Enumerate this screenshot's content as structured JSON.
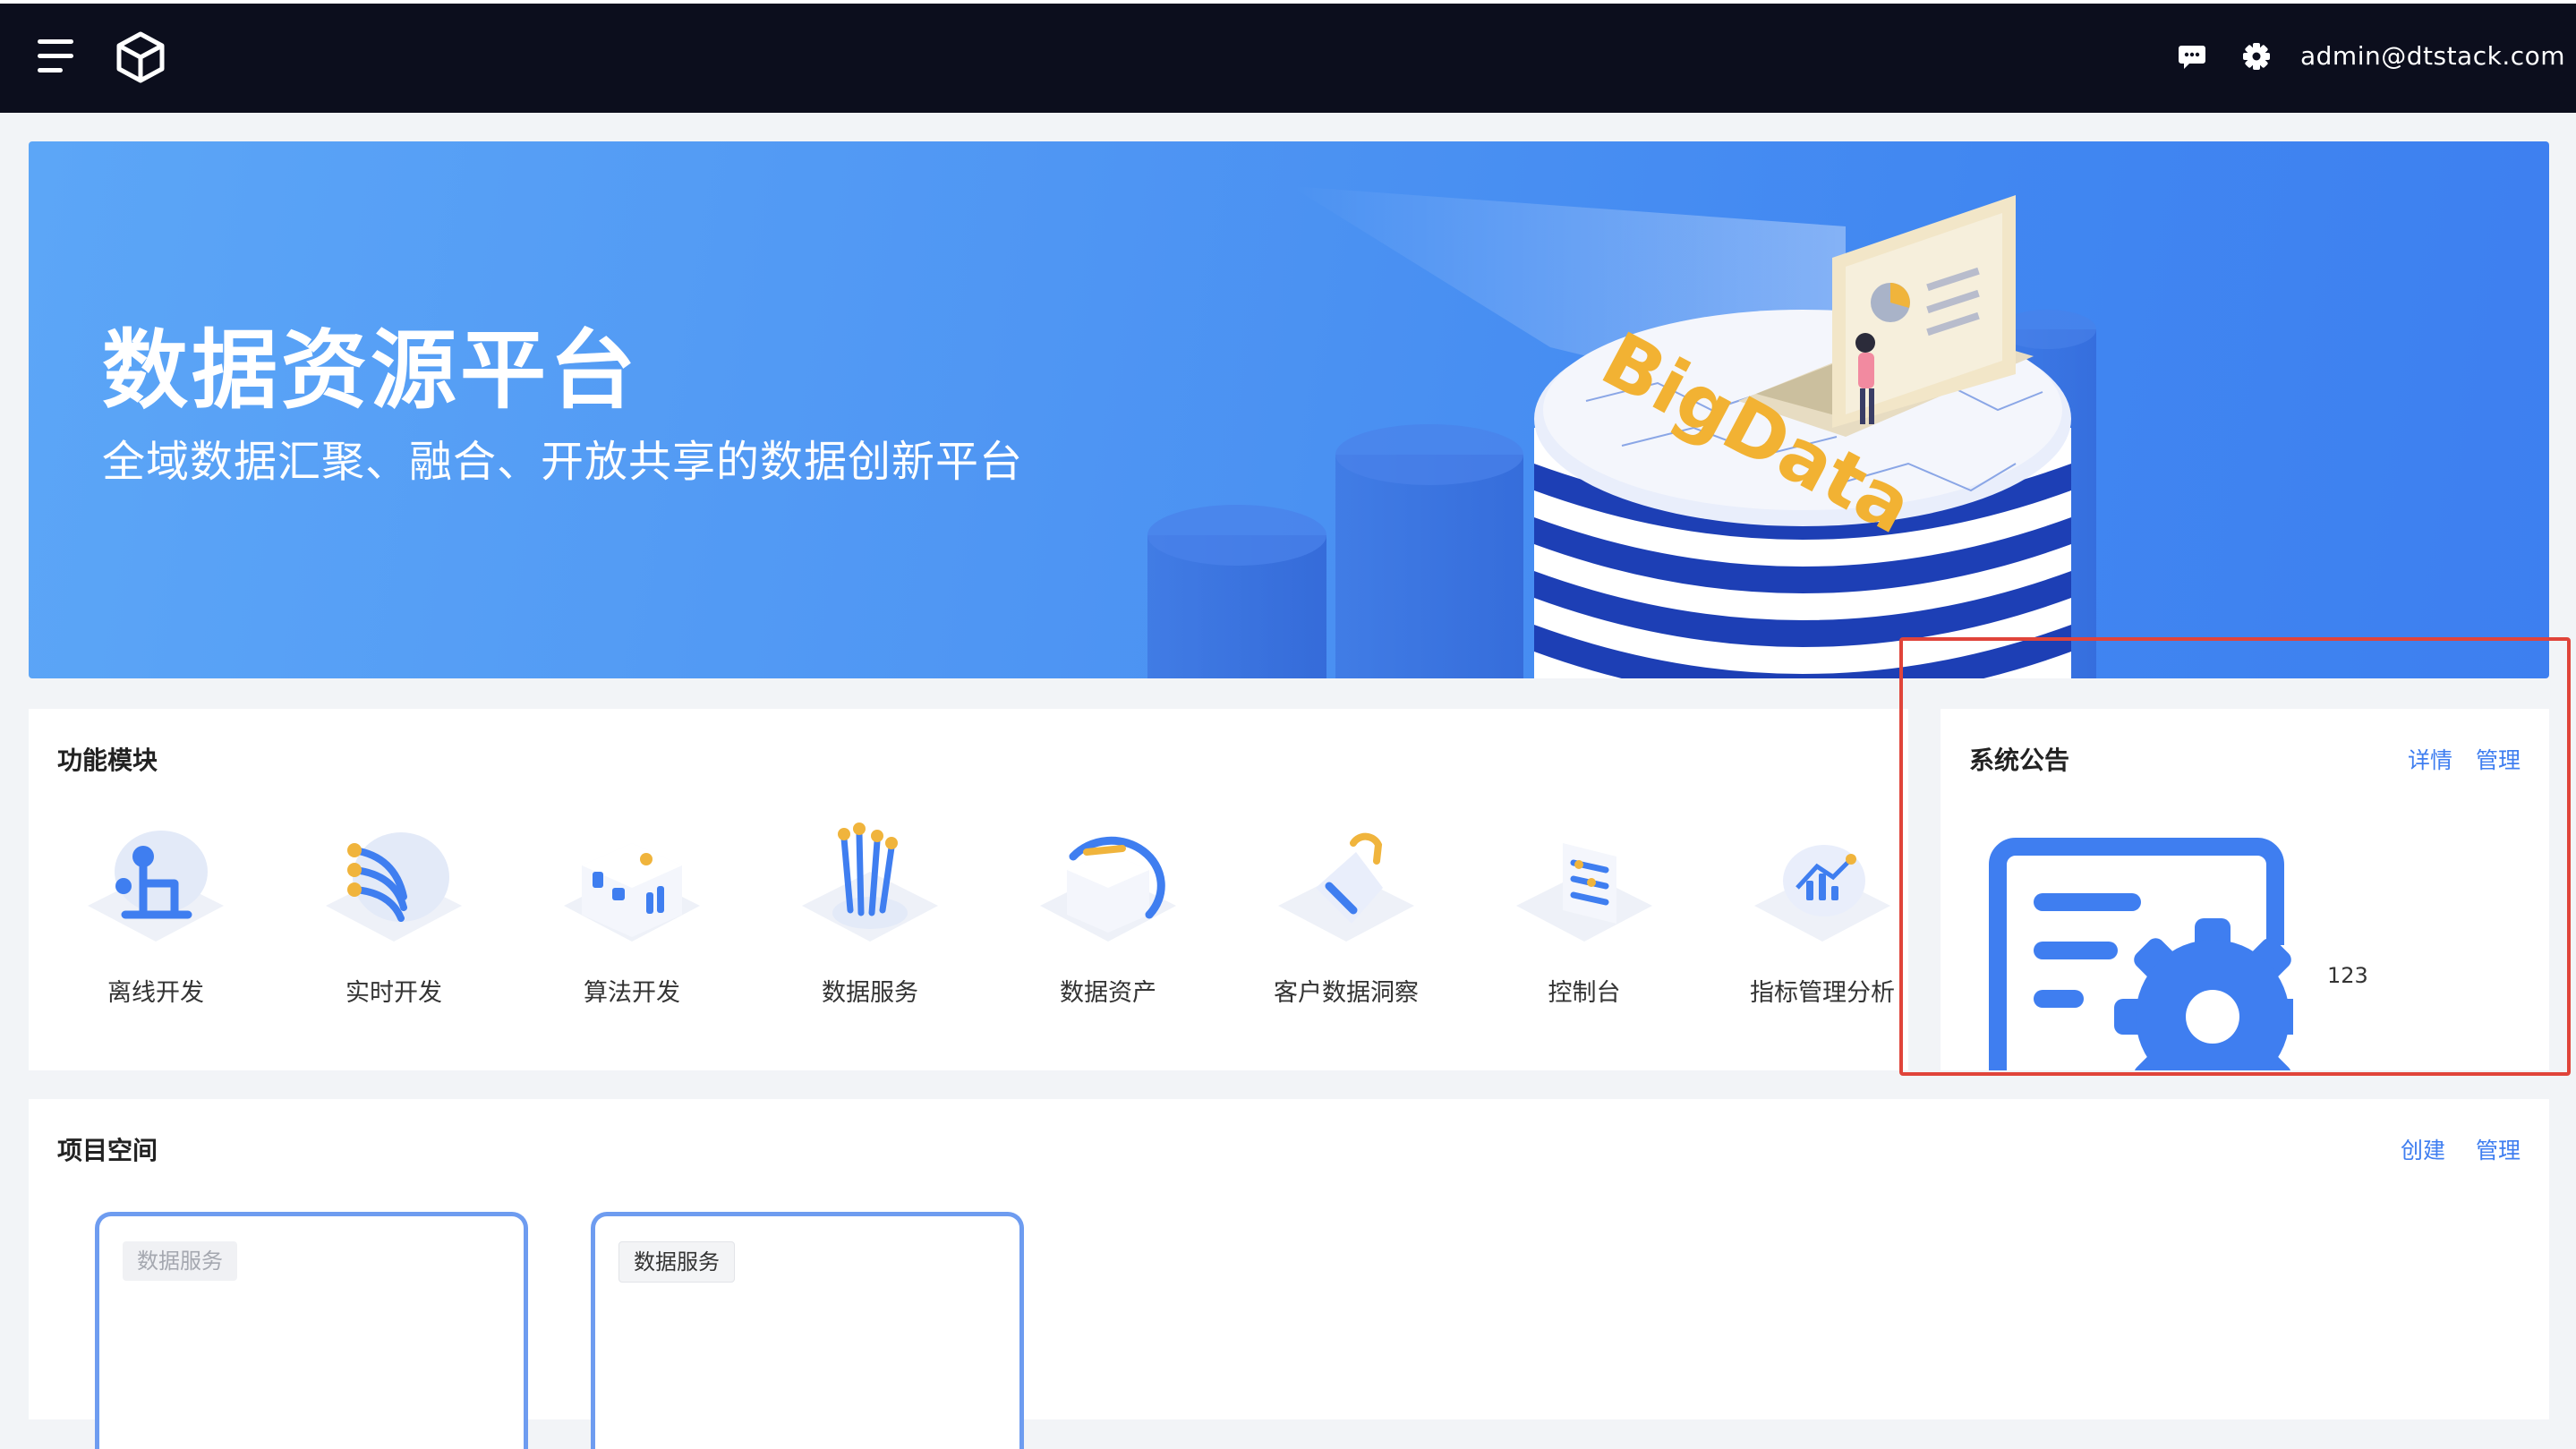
{
  "header": {
    "user": "admin@dtstack.com",
    "icons": [
      "menu-icon",
      "cube-logo-icon",
      "message-icon",
      "gear-icon"
    ]
  },
  "banner": {
    "title": "数据资源平台",
    "subtitle": "全域数据汇聚、融合、开放共享的数据创新平台",
    "illustration_text": "BigData"
  },
  "modules": {
    "title": "功能模块",
    "items": [
      {
        "label": "离线开发",
        "icon": "offline-dev-icon"
      },
      {
        "label": "实时开发",
        "icon": "realtime-dev-icon"
      },
      {
        "label": "算法开发",
        "icon": "algorithm-dev-icon"
      },
      {
        "label": "数据服务",
        "icon": "data-service-icon"
      },
      {
        "label": "数据资产",
        "icon": "data-asset-icon"
      },
      {
        "label": "客户数据洞察",
        "icon": "customer-insight-icon"
      },
      {
        "label": "控制台",
        "icon": "console-icon"
      },
      {
        "label": "指标管理分析",
        "icon": "metric-icon"
      }
    ]
  },
  "notice": {
    "title": "系统公告",
    "detail_link": "详情",
    "manage_link": "管理",
    "count": "123",
    "icon": "notice-settings-icon"
  },
  "projects": {
    "title": "项目空间",
    "create_link": "创建",
    "manage_link": "管理",
    "cards": [
      {
        "tag": "数据服务"
      },
      {
        "tag": "数据服务"
      }
    ]
  },
  "colors": {
    "topbar": "#0c0e1d",
    "accent": "#3f7ef0",
    "banner": "#4f96f3",
    "highlight_box": "#e0443a"
  }
}
